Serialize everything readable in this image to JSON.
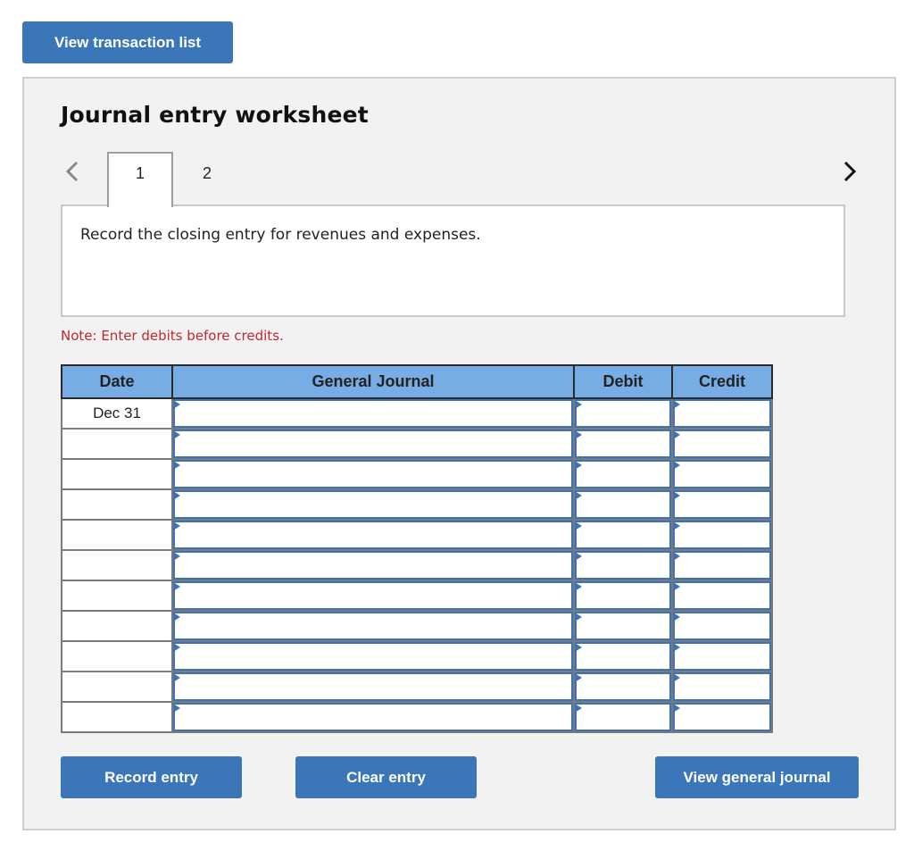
{
  "top_button": {
    "label": "View transaction list"
  },
  "worksheet": {
    "title": "Journal entry worksheet",
    "nav": {
      "prev_icon": "chevron-left-icon",
      "next_icon": "chevron-right-icon"
    },
    "tabs": [
      {
        "label": "1",
        "active": true
      },
      {
        "label": "2",
        "active": false
      }
    ],
    "instruction": "Record the closing entry for revenues and expenses.",
    "note": "Note: Enter debits before credits.",
    "note_color": "#c0282d"
  },
  "journal_table": {
    "columns": [
      "Date",
      "General Journal",
      "Debit",
      "Credit"
    ],
    "rows": [
      {
        "date": "Dec 31",
        "account": "",
        "debit": "",
        "credit": ""
      },
      {
        "date": "",
        "account": "",
        "debit": "",
        "credit": ""
      },
      {
        "date": "",
        "account": "",
        "debit": "",
        "credit": ""
      },
      {
        "date": "",
        "account": "",
        "debit": "",
        "credit": ""
      },
      {
        "date": "",
        "account": "",
        "debit": "",
        "credit": ""
      },
      {
        "date": "",
        "account": "",
        "debit": "",
        "credit": ""
      },
      {
        "date": "",
        "account": "",
        "debit": "",
        "credit": ""
      },
      {
        "date": "",
        "account": "",
        "debit": "",
        "credit": ""
      },
      {
        "date": "",
        "account": "",
        "debit": "",
        "credit": ""
      },
      {
        "date": "",
        "account": "",
        "debit": "",
        "credit": ""
      },
      {
        "date": "",
        "account": "",
        "debit": "",
        "credit": ""
      }
    ]
  },
  "actions": {
    "record": "Record entry",
    "clear": "Clear entry",
    "view_general_journal": "View general journal"
  },
  "colors": {
    "button_bg": "#3a76b8",
    "header_bg": "#78ace4",
    "panel_bg": "#f2f2f2",
    "input_border": "#3f72b5"
  }
}
